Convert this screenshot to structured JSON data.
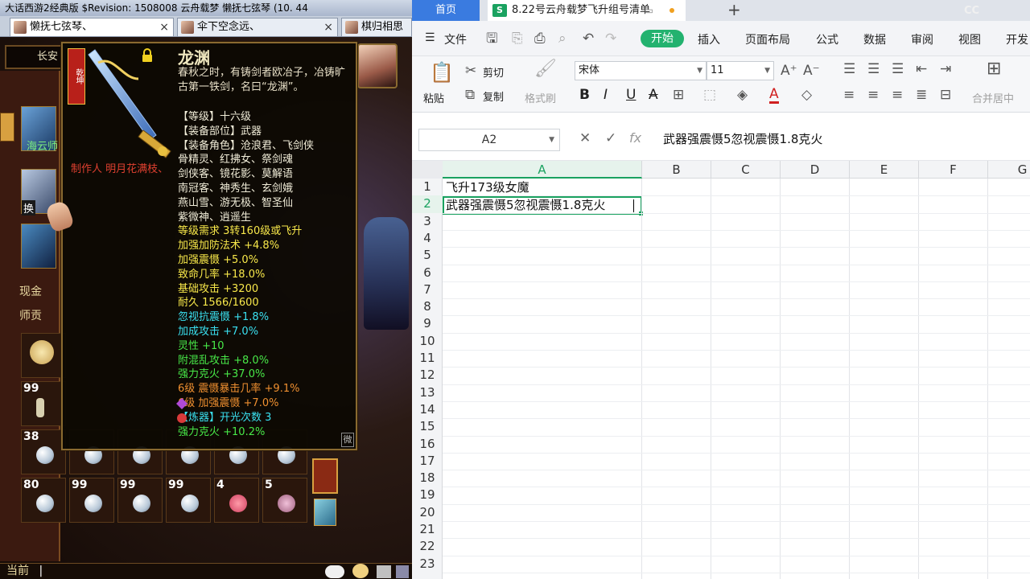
{
  "game": {
    "title_text": "大话西游2经典版 $Revision: 1508008    云舟载梦    懒抚七弦琴 (10. 44",
    "tabs": [
      {
        "label": "懒抚七弦琴、"
      },
      {
        "label": "伞下空念远、"
      },
      {
        "label": "棋归相思"
      }
    ],
    "map_label": "长安",
    "side_labels": {
      "cash": "现金",
      "tribute": "师贡",
      "side_item": "海云师",
      "swap": "换"
    },
    "inventory_counts": [
      "99",
      "38",
      "80",
      "99",
      "99",
      "99",
      "4",
      "5"
    ],
    "chat_prefix": "当前",
    "tooltip": {
      "name": "龙渊",
      "description": "春秋之时，有铸剑者欧冶子，冶铸旷古第一铁剑，名曰“龙渊”。",
      "maker": "制作人  明月花满枝、",
      "badge": "乾坤",
      "corner": "微",
      "lines": [
        {
          "text": "【等级】十六级",
          "color": "white"
        },
        {
          "text": "【装备部位】武器",
          "color": "white"
        },
        {
          "text": "【装备角色】沧浪君、飞剑侠",
          "color": "white"
        },
        {
          "text": "骨精灵、红拂女、祭剑魂",
          "color": "white"
        },
        {
          "text": "剑侠客、镜花影、莫解语",
          "color": "white"
        },
        {
          "text": "南冠客、神秀生、玄剑娥",
          "color": "white"
        },
        {
          "text": "燕山雪、游无极、智圣仙",
          "color": "white"
        },
        {
          "text": "紫微神、逍遥生",
          "color": "white"
        },
        {
          "text": "等级需求 3转160级或飞升",
          "color": "yellow"
        },
        {
          "text": "加强加防法术 +4.8%",
          "color": "yellow"
        },
        {
          "text": "加强震慑 +5.0%",
          "color": "yellow"
        },
        {
          "text": "致命几率 +18.0%",
          "color": "yellow"
        },
        {
          "text": "基础攻击 +3200",
          "color": "yellow"
        },
        {
          "text": "耐久 1566/1600",
          "color": "yellow"
        },
        {
          "text": "忽视抗震慑 +1.8%",
          "color": "cyan"
        },
        {
          "text": "加成攻击 +7.0%",
          "color": "cyan"
        },
        {
          "text": "灵性 +10",
          "color": "green"
        },
        {
          "text": "附混乱攻击 +8.0%",
          "color": "green"
        },
        {
          "text": "强力克火 +37.0%",
          "color": "green"
        },
        {
          "text": "    6级 震慑暴击几率 +9.1%",
          "color": "orange"
        },
        {
          "text": "    6级 加强震慑 +7.0%",
          "color": "orange"
        },
        {
          "text": "【炼器】开光次数 3",
          "color": "cyan"
        },
        {
          "text": "强力克火 +10.2%",
          "color": "green"
        }
      ]
    }
  },
  "wps": {
    "home_tab": "首页",
    "doc_tab": "8.22号云舟载梦飞升组号清单",
    "doc_icon": "S",
    "cc_mark": "CC",
    "menu": {
      "file": "文件",
      "start": "开始",
      "items": [
        "插入",
        "页面布局",
        "公式",
        "数据",
        "审阅",
        "视图",
        "开发"
      ]
    },
    "ribbon": {
      "paste": "粘贴",
      "cut": "剪切",
      "copy": "复制",
      "format_painter": "格式刷",
      "font_name": "宋体",
      "font_size": "11",
      "merge": "合并居中"
    },
    "formula": {
      "name_box": "A2",
      "content": "武器强震慑5忽视震慑1.8克火"
    },
    "columns": [
      "A",
      "B",
      "C",
      "D",
      "E",
      "F",
      "G"
    ],
    "active_column": "A",
    "rows": [
      "1",
      "2",
      "3",
      "4",
      "5",
      "6",
      "7",
      "8",
      "9",
      "10",
      "11",
      "12",
      "13",
      "14",
      "15",
      "16",
      "17",
      "18",
      "19",
      "20",
      "21",
      "22",
      "23"
    ],
    "active_row": "2",
    "cells": {
      "A1": "飞升173级女魔",
      "A2": "武器强震慑5忽视震慑1.8克火"
    }
  }
}
